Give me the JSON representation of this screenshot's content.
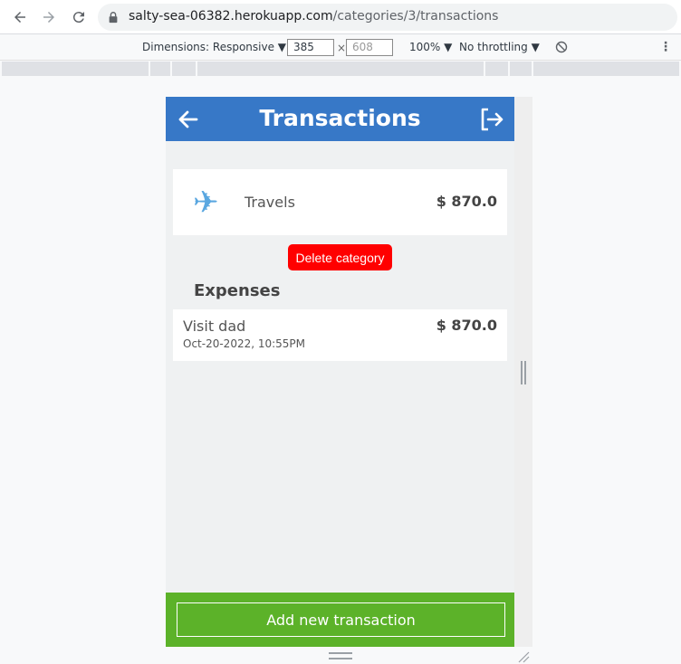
{
  "browser": {
    "url_host": "salty-sea-06382.herokuapp.com",
    "url_path": "/categories/3/transactions"
  },
  "device_toolbar": {
    "dimensions_label": "Dimensions: Responsive ▼",
    "width": "385",
    "times": "×",
    "height": "608",
    "zoom": "100% ▼",
    "throttling": "No throttling ▼"
  },
  "app": {
    "title": "Transactions",
    "category": {
      "icon": "airplane-icon",
      "name": "Travels",
      "amount": "$ 870.0"
    },
    "delete_label": "Delete category",
    "expenses_title": "Expenses",
    "transactions": [
      {
        "name": "Visit dad",
        "date": "Oct-20-2022, 10:55PM",
        "amount": "$ 870.0"
      }
    ],
    "add_label": "Add new transaction"
  },
  "colors": {
    "header": "#3778c7",
    "delete": "#ff0000",
    "add_bar": "#5cb229"
  }
}
